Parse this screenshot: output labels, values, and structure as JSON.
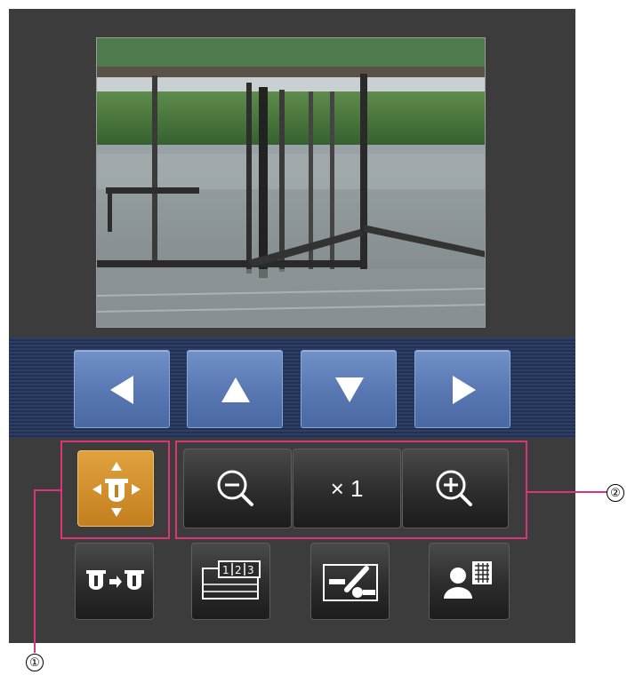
{
  "camera": {
    "description_icon": "camera-live-image"
  },
  "pan_tilt": {
    "buttons": [
      {
        "name": "pan-left-button",
        "icon": "triangle-left-icon"
      },
      {
        "name": "tilt-up-button",
        "icon": "triangle-up-icon"
      },
      {
        "name": "tilt-down-button",
        "icon": "triangle-down-icon"
      },
      {
        "name": "pan-right-button",
        "icon": "triangle-right-icon"
      }
    ]
  },
  "controls": {
    "pan_tilt_mode_icon": "pan-tilt-camera-icon",
    "zoom_out_icon": "zoom-out-icon",
    "zoom_level_label": "× 1",
    "zoom_in_icon": "zoom-in-icon",
    "camera_switch_icon": "camera-switch-icon",
    "preset_icon": "preset-position-icon",
    "brightness_icon": "brightness-adjust-icon",
    "multi_screen_icon": "multi-screen-icon"
  },
  "callouts": {
    "one": "①",
    "two": "②"
  },
  "colors": {
    "accent_orange": "#c47f1e",
    "callout_pink": "#d9357a",
    "arrow_blue": "#5a79b4"
  }
}
